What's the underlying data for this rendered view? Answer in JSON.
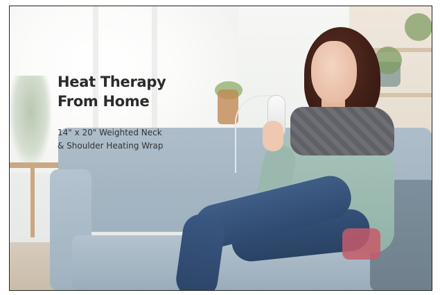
{
  "banner": {
    "headline_line1": "Heat Therapy",
    "headline_line2": "From Home",
    "subline_line1": "14\" x 20\" Weighted Neck",
    "subline_line2": "& Shoulder Heating Wrap"
  },
  "colors": {
    "headline_text": "#2b2b2b",
    "sofa": "#a9b9c6",
    "heating_wrap": "#65676c",
    "sweater": "#9fbdb3",
    "jeans": "#34507a"
  }
}
